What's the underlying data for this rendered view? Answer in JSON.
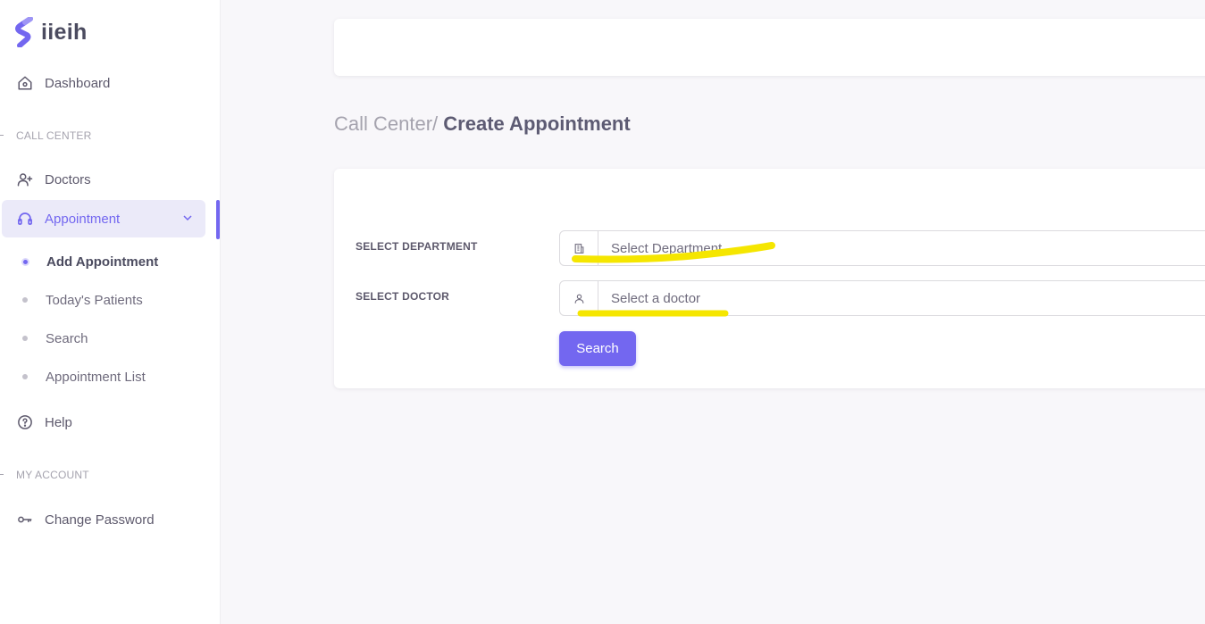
{
  "brand": {
    "name": "iieih",
    "accent": "#7367f0",
    "highlight": "#f5e600"
  },
  "sidebar": {
    "dashboard": {
      "label": "Dashboard",
      "icon": "home-icon"
    },
    "section_call_center": "CALL CENTER",
    "doctors": {
      "label": "Doctors",
      "icon": "user-plus-icon"
    },
    "appointment": {
      "label": "Appointment",
      "icon": "headset-icon"
    },
    "sub_items": [
      {
        "label": "Add Appointment"
      },
      {
        "label": "Today's Patients"
      },
      {
        "label": "Search"
      },
      {
        "label": "Appointment List"
      }
    ],
    "help": {
      "label": "Help",
      "icon": "help-circle-icon"
    },
    "section_my_account": "MY ACCOUNT",
    "change_password": {
      "label": "Change Password",
      "icon": "key-icon"
    }
  },
  "breadcrumb": {
    "parent": "Call Center/",
    "current": "Create Appointment"
  },
  "form": {
    "department": {
      "label": "SELECT DEPARTMENT",
      "value": "Select Department",
      "icon": "building-icon"
    },
    "doctor": {
      "label": "SELECT DOCTOR",
      "value": "Select a doctor",
      "icon": "user-icon"
    },
    "search_label": "Search"
  }
}
